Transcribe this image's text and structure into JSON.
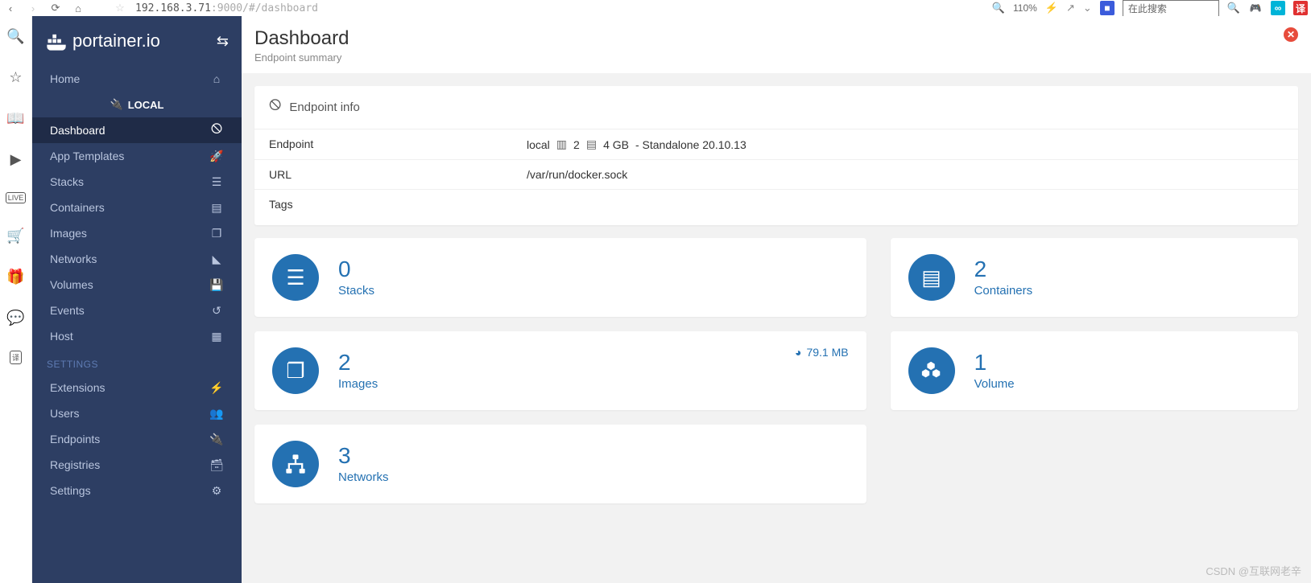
{
  "browser": {
    "url_host": "192.168.3.71",
    "url_path": ":9000/#/dashboard",
    "zoom": "110%",
    "search_placeholder": "在此搜索"
  },
  "sidebar": {
    "logo_text": "portainer.io",
    "home": "Home",
    "local_label": "LOCAL",
    "items": [
      {
        "label": "Dashboard",
        "icon": "tachometer"
      },
      {
        "label": "App Templates",
        "icon": "rocket"
      },
      {
        "label": "Stacks",
        "icon": "th-list"
      },
      {
        "label": "Containers",
        "icon": "server"
      },
      {
        "label": "Images",
        "icon": "clone"
      },
      {
        "label": "Networks",
        "icon": "sitemap"
      },
      {
        "label": "Volumes",
        "icon": "hdd"
      },
      {
        "label": "Events",
        "icon": "history"
      },
      {
        "label": "Host",
        "icon": "th"
      }
    ],
    "settings_heading": "SETTINGS",
    "settings": [
      {
        "label": "Extensions",
        "icon": "bolt"
      },
      {
        "label": "Users",
        "icon": "users"
      },
      {
        "label": "Endpoints",
        "icon": "plug"
      },
      {
        "label": "Registries",
        "icon": "database"
      },
      {
        "label": "Settings",
        "icon": "cogs"
      }
    ]
  },
  "page": {
    "title": "Dashboard",
    "subtitle": "Endpoint summary"
  },
  "endpoint_panel": {
    "heading": "Endpoint info",
    "rows": {
      "endpoint_label": "Endpoint",
      "endpoint_name": "local",
      "cpu_count": "2",
      "mem": "4 GB",
      "mode": "- Standalone 20.10.13",
      "url_label": "URL",
      "url_value": "/var/run/docker.sock",
      "tags_label": "Tags",
      "tags_value": ""
    }
  },
  "tiles": {
    "stacks": {
      "count": "0",
      "label": "Stacks"
    },
    "containers": {
      "count": "2",
      "label": "Containers"
    },
    "images": {
      "count": "2",
      "label": "Images",
      "size": "79.1 MB"
    },
    "volumes": {
      "count": "1",
      "label": "Volume"
    },
    "networks": {
      "count": "3",
      "label": "Networks"
    }
  },
  "watermark": "CSDN @互联网老辛"
}
